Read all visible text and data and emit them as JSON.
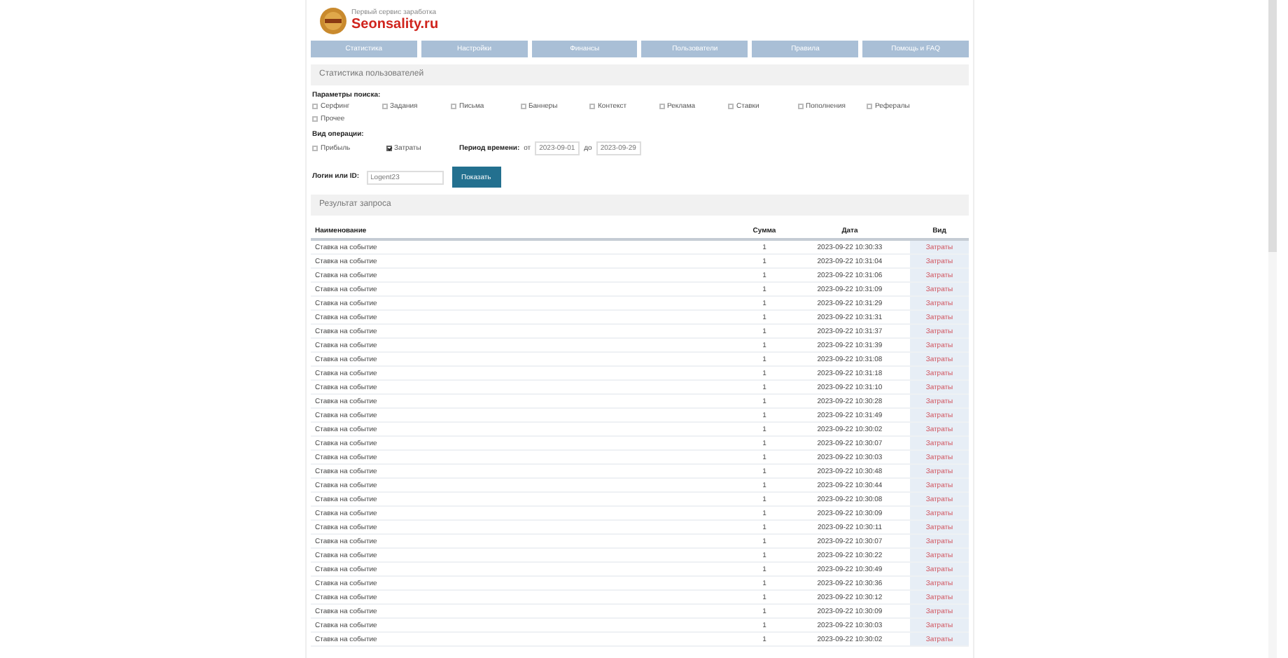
{
  "header": {
    "tagline": "Первый сервис заработка",
    "logo_text": "Seonsality.ru"
  },
  "nav": [
    {
      "label": "Статистика",
      "selected": false
    },
    {
      "label": "Настройки",
      "selected": false
    },
    {
      "label": "Финансы",
      "selected": false
    },
    {
      "label": "Пользователи",
      "selected": false
    },
    {
      "label": "Правила",
      "selected": false
    },
    {
      "label": "Помощь и FAQ",
      "selected": false
    }
  ],
  "panel_title": "Статистика пользователей",
  "search_params": {
    "label": "Параметры поиска:",
    "options": [
      {
        "label": "Серфинг",
        "checked": false
      },
      {
        "label": "Задания",
        "checked": false
      },
      {
        "label": "Письма",
        "checked": false
      },
      {
        "label": "Баннеры",
        "checked": false
      },
      {
        "label": "Контекст",
        "checked": false
      },
      {
        "label": "Реклама",
        "checked": false
      },
      {
        "label": "Ставки",
        "checked": false
      },
      {
        "label": "Пополнения",
        "checked": false
      },
      {
        "label": "Рефералы",
        "checked": false
      },
      {
        "label": "Прочее",
        "checked": false
      }
    ]
  },
  "operation": {
    "label": "Вид операции:",
    "options": [
      {
        "label": "Прибыль",
        "checked": false
      },
      {
        "label": "Затраты",
        "checked": true
      }
    ],
    "period_label": "Период времени:",
    "from_label": "от",
    "from_value": "2023-09-01",
    "to_label": "до",
    "to_value": "2023-09-29"
  },
  "login": {
    "label": "Логин или ID:",
    "value": "Logent23",
    "button": "Показать"
  },
  "results_title": "Результат запроса",
  "table": {
    "columns": [
      "Наименование",
      "Сумма",
      "Дата",
      "Вид"
    ],
    "rows": [
      [
        "Ставка на событие",
        "1",
        "2023-09-22 10:30:33",
        "Затраты"
      ],
      [
        "Ставка на событие",
        "1",
        "2023-09-22 10:31:04",
        "Затраты"
      ],
      [
        "Ставка на событие",
        "1",
        "2023-09-22 10:31:06",
        "Затраты"
      ],
      [
        "Ставка на событие",
        "1",
        "2023-09-22 10:31:09",
        "Затраты"
      ],
      [
        "Ставка на событие",
        "1",
        "2023-09-22 10:31:29",
        "Затраты"
      ],
      [
        "Ставка на событие",
        "1",
        "2023-09-22 10:31:31",
        "Затраты"
      ],
      [
        "Ставка на событие",
        "1",
        "2023-09-22 10:31:37",
        "Затраты"
      ],
      [
        "Ставка на событие",
        "1",
        "2023-09-22 10:31:39",
        "Затраты"
      ],
      [
        "Ставка на событие",
        "1",
        "2023-09-22 10:31:08",
        "Затраты"
      ],
      [
        "Ставка на событие",
        "1",
        "2023-09-22 10:31:18",
        "Затраты"
      ],
      [
        "Ставка на событие",
        "1",
        "2023-09-22 10:31:10",
        "Затраты"
      ],
      [
        "Ставка на событие",
        "1",
        "2023-09-22 10:30:28",
        "Затраты"
      ],
      [
        "Ставка на событие",
        "1",
        "2023-09-22 10:31:49",
        "Затраты"
      ],
      [
        "Ставка на событие",
        "1",
        "2023-09-22 10:30:02",
        "Затраты"
      ],
      [
        "Ставка на событие",
        "1",
        "2023-09-22 10:30:07",
        "Затраты"
      ],
      [
        "Ставка на событие",
        "1",
        "2023-09-22 10:30:03",
        "Затраты"
      ],
      [
        "Ставка на событие",
        "1",
        "2023-09-22 10:30:48",
        "Затраты"
      ],
      [
        "Ставка на событие",
        "1",
        "2023-09-22 10:30:44",
        "Затраты"
      ],
      [
        "Ставка на событие",
        "1",
        "2023-09-22 10:30:08",
        "Затраты"
      ],
      [
        "Ставка на событие",
        "1",
        "2023-09-22 10:30:09",
        "Затраты"
      ],
      [
        "Ставка на событие",
        "1",
        "2023-09-22 10:30:11",
        "Затраты"
      ],
      [
        "Ставка на событие",
        "1",
        "2023-09-22 10:30:07",
        "Затраты"
      ],
      [
        "Ставка на событие",
        "1",
        "2023-09-22 10:30:22",
        "Затраты"
      ],
      [
        "Ставка на событие",
        "1",
        "2023-09-22 10:30:49",
        "Затраты"
      ],
      [
        "Ставка на событие",
        "1",
        "2023-09-22 10:30:36",
        "Затраты"
      ],
      [
        "Ставка на событие",
        "1",
        "2023-09-22 10:30:12",
        "Затраты"
      ],
      [
        "Ставка на событие",
        "1",
        "2023-09-22 10:30:09",
        "Затраты"
      ],
      [
        "Ставка на событие",
        "1",
        "2023-09-22 10:30:03",
        "Затраты"
      ],
      [
        "Ставка на событие",
        "1",
        "2023-09-22 10:30:02",
        "Затраты"
      ]
    ]
  }
}
